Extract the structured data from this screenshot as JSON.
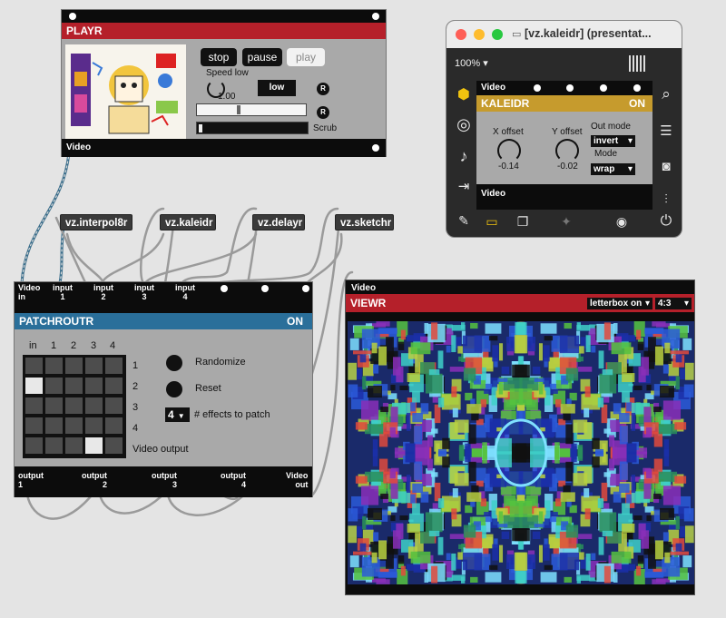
{
  "playr": {
    "title": "PLAYR",
    "stop_label": "stop",
    "pause_label": "pause",
    "play_label": "play",
    "speed_label": "Speed low",
    "speed_value": "1.00",
    "low_button": "low",
    "r_label": "R",
    "scrub_label": "Scrub",
    "video_label": "Video"
  },
  "objects": {
    "interpol": "vz.interpol8r",
    "kaleidr": "vz.kaleidr",
    "delayr": "vz.delayr",
    "sketchr": "vz.sketchr"
  },
  "patchroutr": {
    "title": "PATCHROUTR",
    "status": "ON",
    "inputs": {
      "video_in": [
        "Video",
        "in"
      ],
      "in1": [
        "input",
        "1"
      ],
      "in2": [
        "input",
        "2"
      ],
      "in3": [
        "input",
        "3"
      ],
      "in4": [
        "input",
        "4"
      ]
    },
    "col_headers": [
      "in",
      "1",
      "2",
      "3",
      "4"
    ],
    "row_labels": [
      "1",
      "2",
      "3",
      "4",
      "Video output"
    ],
    "matrix": [
      [
        0,
        0,
        0,
        0,
        0
      ],
      [
        1,
        0,
        0,
        0,
        0
      ],
      [
        0,
        0,
        0,
        0,
        0
      ],
      [
        0,
        0,
        0,
        0,
        0
      ],
      [
        0,
        0,
        0,
        1,
        0
      ]
    ],
    "randomize_label": "Randomize",
    "reset_label": "Reset",
    "effects_count": "4",
    "effects_label": "# effects to patch",
    "outputs": {
      "o1": [
        "output",
        "1"
      ],
      "o2": [
        "output",
        "2"
      ],
      "o3": [
        "output",
        "3"
      ],
      "o4": [
        "output",
        "4"
      ],
      "video_out": [
        "Video",
        "out"
      ]
    }
  },
  "window": {
    "title": "[vz.kaleidr] (presentat...",
    "zoom": "100%",
    "video_label": "Video",
    "kaleidr_title": "KALEIDR",
    "kaleidr_status": "ON",
    "x_offset_label": "X offset",
    "x_offset_value": "-0.14",
    "y_offset_label": "Y offset",
    "y_offset_value": "-0.02",
    "out_mode_label": "Out mode",
    "out_mode_value": "invert",
    "mode_label": "Mode",
    "mode_value": "wrap",
    "video_out_label": "Video"
  },
  "viewr": {
    "video_label": "Video",
    "title": "VIEWR",
    "letterbox": "letterbox on",
    "aspect": "4:3"
  },
  "colors": {
    "playr_red": "#b5202a",
    "patch_blue": "#2a6f9a",
    "kaleidr_gold": "#c69b2d",
    "viewr_red": "#b5202a"
  }
}
